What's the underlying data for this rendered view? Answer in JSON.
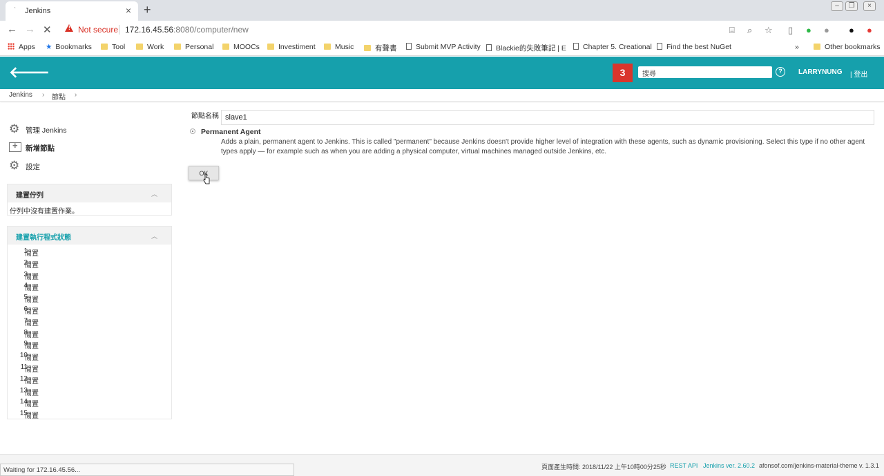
{
  "browser": {
    "tab_title": "Jenkins",
    "new_tab": "+",
    "security_label": "Not secure",
    "url_host": "172.16.45.56",
    "url_path": ":8080/computer/new",
    "bookmarks": [
      "Apps",
      "Bookmarks",
      "Tool",
      "Work",
      "Personal",
      "MOOCs",
      "Investiment",
      "Music",
      "有聲書",
      "Submit MVP Activity",
      "Blackie的失敗筆記 | E",
      "Chapter 5. Creational",
      "Find the best NuGet",
      "Other bookmarks"
    ],
    "bookmarks_more": "»",
    "status_text": "Waiting for 172.16.45.56..."
  },
  "header": {
    "notification_count": "3",
    "search_placeholder": "搜尋",
    "help": "?",
    "user": "LARRYNUNG",
    "logout": "| 登出"
  },
  "breadcrumb": [
    "Jenkins",
    "節點"
  ],
  "sidebar": {
    "tasks": [
      "管理 Jenkins",
      "新增節點",
      "設定"
    ],
    "queue_title": "建置佇列",
    "queue_empty": "佇列中沒有建置作業。",
    "executors_title": "建置執行程式狀態",
    "executors": [
      {
        "n": "1",
        "s": "閒置"
      },
      {
        "n": "2",
        "s": "閒置"
      },
      {
        "n": "3",
        "s": "閒置"
      },
      {
        "n": "4",
        "s": "閒置"
      },
      {
        "n": "5",
        "s": "閒置"
      },
      {
        "n": "6",
        "s": "閒置"
      },
      {
        "n": "7",
        "s": "閒置"
      },
      {
        "n": "8",
        "s": "閒置"
      },
      {
        "n": "9",
        "s": "閒置"
      },
      {
        "n": "10",
        "s": "閒置"
      },
      {
        "n": "11",
        "s": "閒置"
      },
      {
        "n": "12",
        "s": "閒置"
      },
      {
        "n": "13",
        "s": "閒置"
      },
      {
        "n": "14",
        "s": "閒置"
      },
      {
        "n": "15",
        "s": "閒置"
      }
    ]
  },
  "form": {
    "name_label": "節點名稱",
    "name_value": "slave1",
    "agent_type": "Permanent Agent",
    "agent_desc": "Adds a plain, permanent agent to Jenkins. This is called \"permanent\" because Jenkins doesn't provide higher level of integration with these agents, such as dynamic provisioning. Select this type if no other agent types apply — for example such as when you are adding a physical computer, virtual machines managed outside Jenkins, etc.",
    "ok": "OK"
  },
  "footer": {
    "generated": "頁面產生時間: 2018/11/22 上午10時00分25秒",
    "rest_api": "REST API",
    "version": "Jenkins ver. 2.60.2",
    "theme": "afonsof.com/jenkins-material-theme v. 1.3.1"
  },
  "colors": {
    "header": "#16a0ac",
    "badge": "#d9352c"
  }
}
